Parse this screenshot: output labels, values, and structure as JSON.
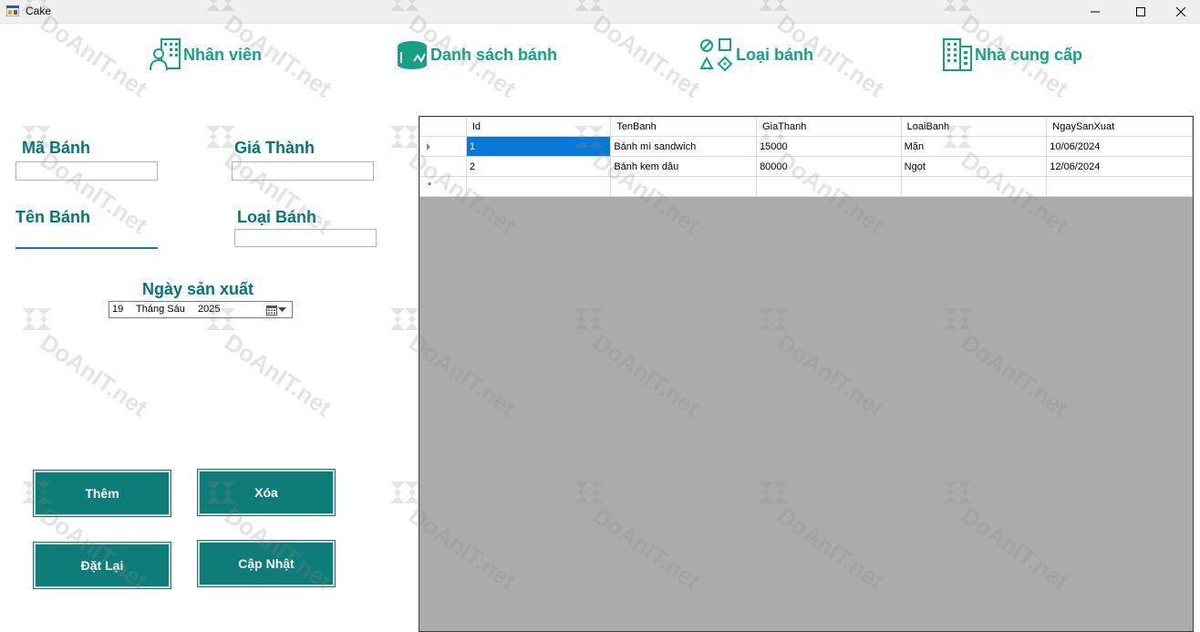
{
  "window": {
    "title": "Cake",
    "minimize_glyph": "—",
    "maximize_glyph": "☐",
    "close_glyph": "✕"
  },
  "nav": [
    {
      "label": "Nhân viên",
      "icon": "employee-icon"
    },
    {
      "label": "Danh sách bánh",
      "icon": "cake-list-icon"
    },
    {
      "label": "Loại bánh",
      "icon": "categories-icon"
    },
    {
      "label": "Nhà cung cấp",
      "icon": "building-icon"
    }
  ],
  "form": {
    "ma_banh_label": "Mã Bánh",
    "ma_banh_value": "",
    "gia_thanh_label": "Giá Thành",
    "gia_thanh_value": "",
    "ten_banh_label": "Tên Bánh",
    "ten_banh_value": "",
    "loai_banh_label": "Loại Bánh",
    "loai_banh_value": "",
    "ngay_label": "Ngày sản xuất",
    "date_day": "19",
    "date_month": "Tháng Sáu",
    "date_year": "2025"
  },
  "buttons": {
    "them": "Thêm",
    "xoa": "Xóa",
    "dat_lai": "Đặt Lại",
    "cap_nhat": "Cập Nhật"
  },
  "grid": {
    "columns": [
      "Id",
      "TenBanh",
      "GiaThanh",
      "LoaiBanh",
      "NgaySanXuat"
    ],
    "rows": [
      [
        "1",
        "Bánh mì sandwich",
        "15000",
        "Mặn",
        "10/06/2024"
      ],
      [
        "2",
        "Bánh kem dâu",
        "80000",
        "Ngọt",
        "12/06/2024"
      ]
    ],
    "new_row_marker": "*"
  },
  "watermark": {
    "text": "DoAnIT.net"
  },
  "colors": {
    "accent": "#16a085",
    "label": "#00777a",
    "button": "#0e7d79",
    "selection": "#0a78d7",
    "grid_bg": "#ababab"
  }
}
